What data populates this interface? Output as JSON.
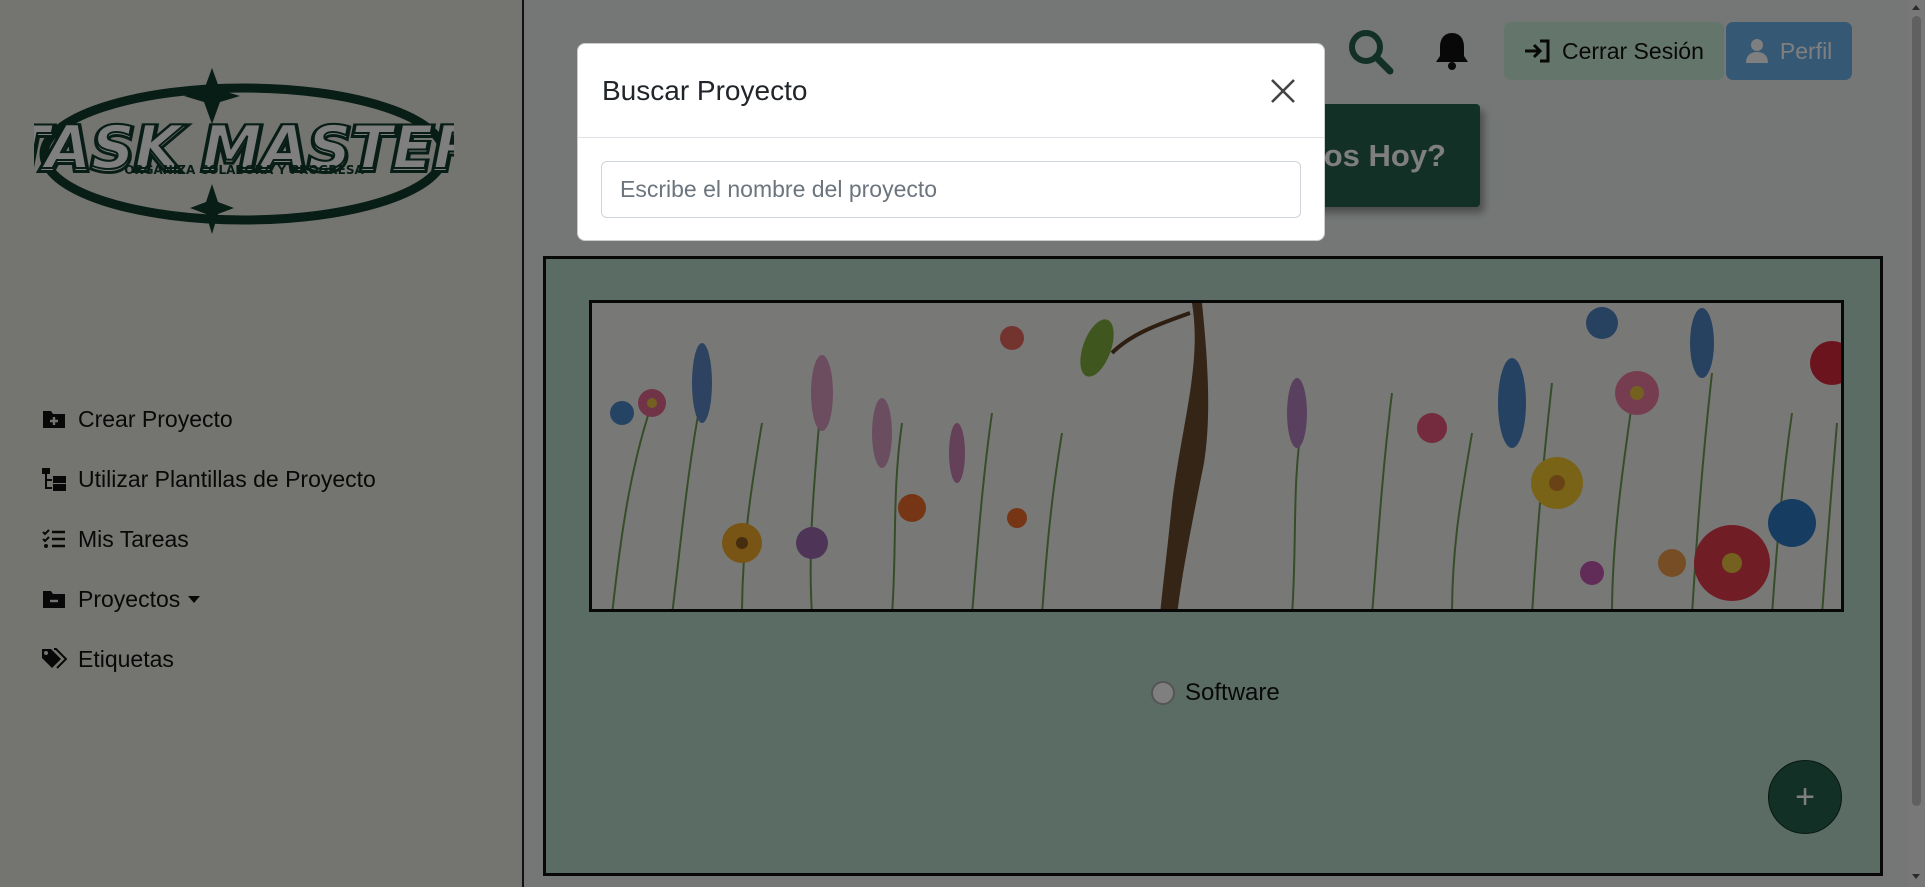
{
  "app": {
    "logo_text": "TASK MASTER",
    "logo_tagline": "ORGANIZA COLABORA Y PROGRESA"
  },
  "sidebar": {
    "items": [
      {
        "label": "Crear Proyecto",
        "icon": "folder-plus-icon"
      },
      {
        "label": "Utilizar Plantillas de Proyecto",
        "icon": "folder-tree-icon"
      },
      {
        "label": "Mis Tareas",
        "icon": "list-check-icon"
      },
      {
        "label": "Proyectos",
        "icon": "folder-minus-icon",
        "dropdown": true
      },
      {
        "label": "Etiquetas",
        "icon": "tags-icon"
      }
    ]
  },
  "header": {
    "search_icon": "search-icon",
    "bell_icon": "bell-icon",
    "logout_label": "Cerrar Sesión",
    "profile_label": "Perfil"
  },
  "hero": {
    "partial_label": "nos Hoy?"
  },
  "main": {
    "project_option": "Software",
    "fab_label": "+"
  },
  "modal": {
    "title": "Buscar Proyecto",
    "search_placeholder": "Escribe el nombre del proyecto",
    "search_value": ""
  },
  "colors": {
    "brand_dark_green": "#27604c",
    "panel_green": "#b4d9c8",
    "logout_bg": "#c9ead9",
    "profile_bg": "#6ab0ea",
    "sidebar_bg": "#e9e8e1"
  }
}
